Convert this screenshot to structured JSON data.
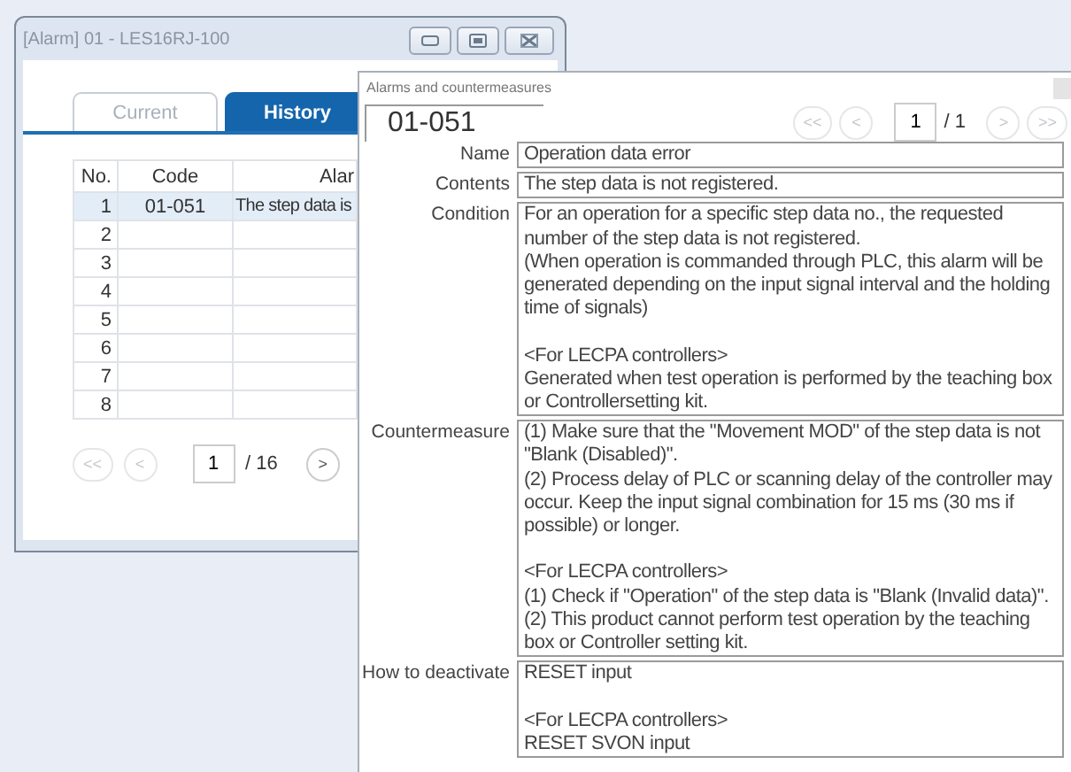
{
  "main_window": {
    "title": "[Alarm] 01 - LES16RJ-100",
    "tabs": [
      {
        "label": "Current",
        "selected": false
      },
      {
        "label": "History",
        "selected": true
      }
    ],
    "table": {
      "columns": [
        "No.",
        "Code",
        "Alar"
      ],
      "rows": [
        {
          "no": "1",
          "code": "01-051",
          "alarm": "The step data is",
          "selected": true
        },
        {
          "no": "2",
          "selected": false
        },
        {
          "no": "3",
          "selected": false
        },
        {
          "no": "4",
          "selected": false
        },
        {
          "no": "5",
          "selected": false
        },
        {
          "no": "6",
          "selected": false
        },
        {
          "no": "7",
          "selected": false
        },
        {
          "no": "8",
          "selected": false
        }
      ]
    },
    "pager": {
      "before": [
        {
          "label": "<<",
          "disabled": true
        },
        {
          "label": "<",
          "disabled": true
        }
      ],
      "page": "1",
      "total": "/ 16",
      "after": [
        {
          "label": ">",
          "disabled": false
        }
      ]
    }
  },
  "popup": {
    "title": "Alarms and countermeasures",
    "code": "01-051",
    "pager": {
      "before": [
        {
          "label": "<<",
          "disabled": true
        },
        {
          "label": "<",
          "disabled": true
        }
      ],
      "page": "1",
      "total": "/ 1",
      "after": [
        {
          "label": ">",
          "disabled": true
        },
        {
          "label": ">>",
          "disabled": true
        }
      ]
    },
    "fields": [
      {
        "label": "Name",
        "value": "Operation data error"
      },
      {
        "label": "Contents",
        "value": "The step data is not registered."
      },
      {
        "label": "Condition",
        "value": "For an operation for a specific step data no., the requested number of the step data is not registered.\n(When operation is commanded through PLC, this alarm will be generated depending on the input signal interval and the holding time of signals)\n\n<For LECPA controllers>\nGenerated when test operation is performed by the teaching box or Controllersetting kit."
      },
      {
        "label": "Countermeasure",
        "value": "(1) Make sure that the \"Movement MOD\" of the step data is not \"Blank (Disabled)\".\n(2) Process delay of PLC or scanning delay of the controller may occur. Keep the input signal combination for 15 ms (30 ms if possible) or longer.\n\n<For LECPA controllers>\n(1) Check if \"Operation\" of the step data is \"Blank (Invalid data)\".\n(2) This product cannot perform test operation by the teaching box or Controller setting kit."
      },
      {
        "label": "How to deactivate",
        "value": "RESET input\n\n<For LECPA controllers>\nRESET SVON input"
      }
    ]
  }
}
